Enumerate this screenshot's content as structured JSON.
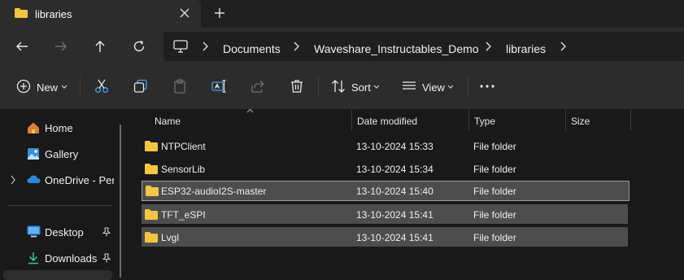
{
  "tab": {
    "title": "libraries"
  },
  "breadcrumb": [
    "Documents",
    "Waveshare_Instructables_Demo",
    "libraries"
  ],
  "toolbar": {
    "new_label": "New",
    "sort_label": "Sort",
    "view_label": "View"
  },
  "nav": {
    "items": [
      {
        "label": "Home"
      },
      {
        "label": "Gallery"
      },
      {
        "label": "OneDrive - Personal"
      },
      {
        "label": "Desktop"
      },
      {
        "label": "Downloads"
      }
    ]
  },
  "columns": {
    "name": "Name",
    "date": "Date modified",
    "type": "Type",
    "size": "Size"
  },
  "files": [
    {
      "name": "NTPClient",
      "date": "13-10-2024 15:33",
      "type": "File folder",
      "selected": false
    },
    {
      "name": "SensorLib",
      "date": "13-10-2024 15:34",
      "type": "File folder",
      "selected": false
    },
    {
      "name": "ESP32-audioI2S-master",
      "date": "13-10-2024 15:40",
      "type": "File folder",
      "selected": true
    },
    {
      "name": "TFT_eSPI",
      "date": "13-10-2024 15:41",
      "type": "File folder",
      "selected": true
    },
    {
      "name": "Lvgl",
      "date": "13-10-2024 15:41",
      "type": "File folder",
      "selected": true
    }
  ],
  "colors": {
    "folder": "#f4c542",
    "accent": "#4ba0e8",
    "selection": "#4d4d4d"
  }
}
